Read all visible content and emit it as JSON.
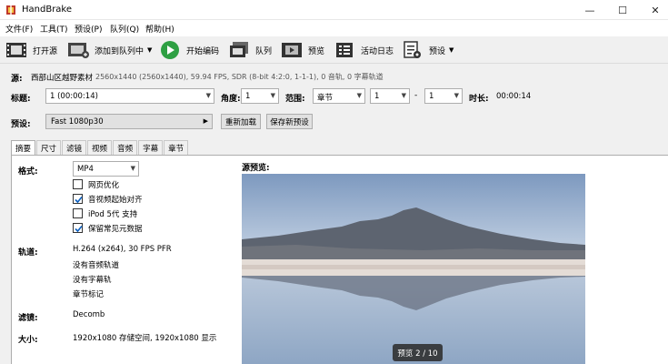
{
  "app": {
    "title": "HandBrake"
  },
  "window_controls": {
    "minimize": "—",
    "maximize": "☐",
    "close": "✕"
  },
  "menu": [
    "文件(F)",
    "工具(T)",
    "预设(P)",
    "队列(Q)",
    "帮助(H)"
  ],
  "toolbar": {
    "open_source": "打开源",
    "add_to_queue": "添加到队列中",
    "start_encode": "开始编码",
    "queue": "队列",
    "preview": "预览",
    "activity_log": "活动日志",
    "presets": "预设"
  },
  "source": {
    "label": "源:",
    "name": "西部山区越野素材",
    "info": "2560x1440 (2560x1440), 59.94 FPS, SDR (8-bit 4:2:0, 1-1-1), 0 音轨, 0 字幕轨道"
  },
  "title_row": {
    "title_label": "标题:",
    "title_value": "1 (00:00:14)",
    "angle_label": "角度:",
    "angle_value": "1",
    "range_label": "范围:",
    "range_type": "章节",
    "range_start": "1",
    "range_dash": "-",
    "range_end": "1",
    "duration_label": "时长:",
    "duration_value": "00:00:14"
  },
  "preset_row": {
    "label": "预设:",
    "value": "Fast 1080p30",
    "reload_button": "重新加载",
    "save_new_button": "保存新预设"
  },
  "tabs": [
    "摘要",
    "尺寸",
    "滤镜",
    "视频",
    "音频",
    "字幕",
    "章节"
  ],
  "summary": {
    "format_label": "格式:",
    "format_value": "MP4",
    "options": [
      {
        "label": "网页优化",
        "checked": false
      },
      {
        "label": "音视频起始对齐",
        "checked": true
      },
      {
        "label": "iPod 5代 支持",
        "checked": false
      },
      {
        "label": "保留常见元数据",
        "checked": true
      }
    ],
    "tracks_label": "轨道:",
    "tracks": [
      "H.264 (x264), 30 FPS PFR",
      "没有音频轨道",
      "没有字幕轨",
      "章节标记"
    ],
    "filters_label": "滤镜:",
    "filters_value": "Decomb",
    "size_label": "大小:",
    "size_value": "1920x1080 存储空间, 1920x1080 显示",
    "preview_label": "源预览:",
    "preview_badge": "预览 2 / 10"
  },
  "colors": {
    "start_green": "#2ea043",
    "sky_top": "#8fa8c8",
    "water": "#a7b9cf"
  }
}
